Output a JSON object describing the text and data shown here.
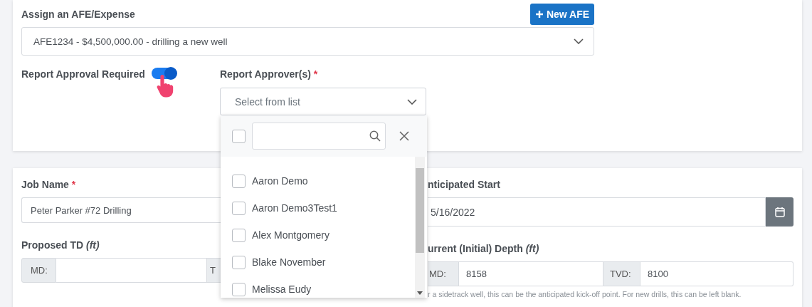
{
  "afe_section": {
    "label": "Assign an AFE/Expense",
    "new_button": "New AFE",
    "select_value": "AFE1234 - $4,500,000.00 - drilling a new well"
  },
  "approval": {
    "label": "Report Approval Required",
    "on": true
  },
  "approvers": {
    "label": "Report Approver(s)",
    "required_mark": "*",
    "placeholder": "Select from list",
    "expanded": true,
    "select_all_checked": false,
    "options": [
      {
        "label": "Aaron Demo",
        "checked": false
      },
      {
        "label": "Aaron Demo3Test1",
        "checked": false
      },
      {
        "label": "Alex Montgomery",
        "checked": false
      },
      {
        "label": "Blake November",
        "checked": false
      },
      {
        "label": "Melissa Eudy",
        "checked": false
      }
    ]
  },
  "job_name": {
    "label": "Job Name",
    "required_mark": "*",
    "value": "Peter Parker #72 Drilling"
  },
  "anticipated_start": {
    "label": "nticipated Start",
    "value": "5/16/2022"
  },
  "proposed_td": {
    "label": "Proposed TD *(ft)*",
    "md_label": "MD:",
    "tvd_label": "T"
  },
  "current_depth": {
    "label": "urrent (Initial) Depth *(ft)*",
    "md_label": "MD:",
    "md_value": "8158",
    "tvd_label": "TVD:",
    "tvd_value": "8100",
    "help": "r a sidetrack well, this can be the anticipated kick-off point. For new drills, this can be left blank."
  }
}
